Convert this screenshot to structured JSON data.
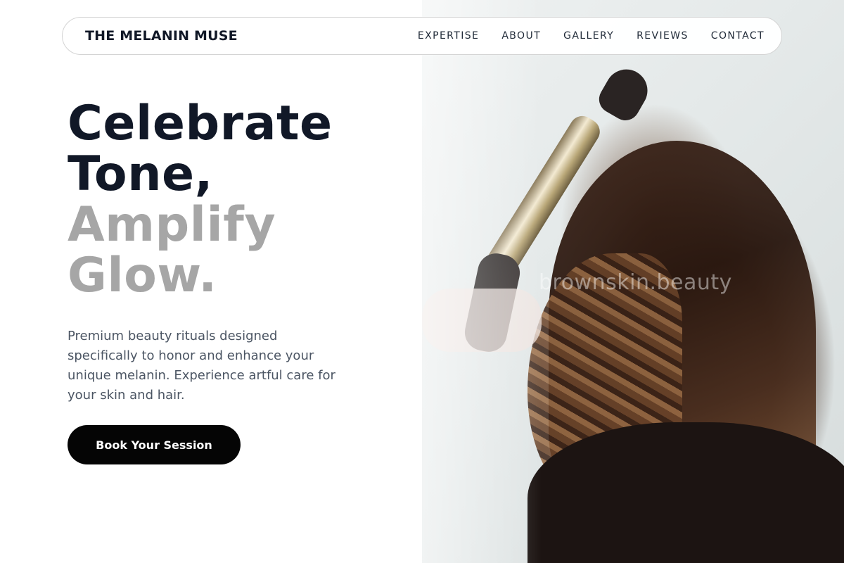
{
  "brand": {
    "name": "THE MELANIN MUSE"
  },
  "nav": {
    "links": [
      "EXPERTISE",
      "ABOUT",
      "GALLERY",
      "REVIEWS",
      "CONTACT"
    ]
  },
  "hero": {
    "headline_line1": "Celebrate",
    "headline_line2": "Tone,",
    "headline_line3": "Amplify",
    "headline_line4": "Glow.",
    "description": "Premium beauty rituals designed specifically to honor and enhance your unique melanin. Experience artful care for your skin and hair.",
    "cta_label": "Book Your Session"
  },
  "image": {
    "watermark": "brownskin.beauty"
  },
  "colors": {
    "headline_dark": "#111827",
    "headline_light": "#a6a6a6",
    "cta_bg": "#050505",
    "body_text": "#4b5563"
  }
}
